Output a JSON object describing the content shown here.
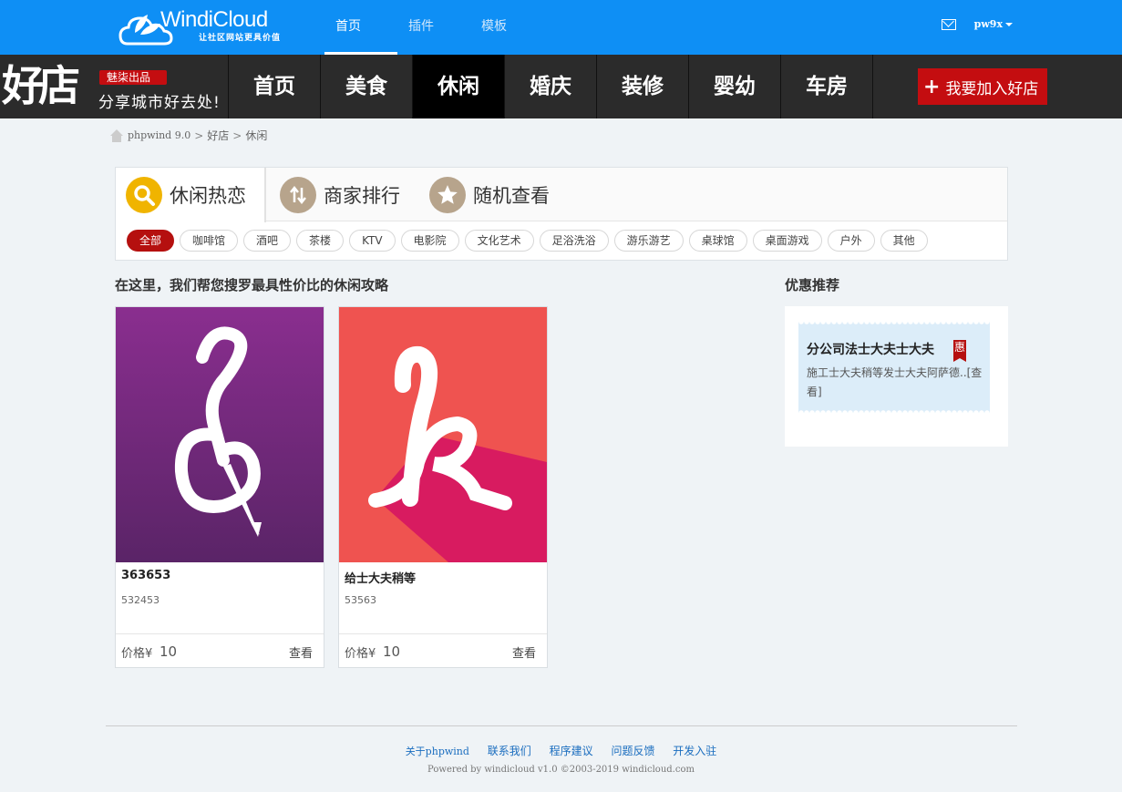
{
  "topbar": {
    "brand": "WindiCloud",
    "slogan": "让社区网站更具价值",
    "nav": [
      "首页",
      "插件",
      "模板"
    ],
    "active_nav": "首页",
    "user": "pw9x"
  },
  "shop": {
    "logo_text": "好店",
    "badge": "魅柒出品",
    "tagline": "分享城市好去处!",
    "categories": [
      "首页",
      "美食",
      "休闲",
      "婚庆",
      "装修",
      "婴幼",
      "车房"
    ],
    "active_category": "休闲",
    "join_label": "我要加入好店"
  },
  "breadcrumb": [
    "phpwind 9.0",
    "好店",
    "休闲"
  ],
  "tabs": [
    {
      "label": "休闲热恋",
      "icon": "search-icon",
      "color": "#f0b400"
    },
    {
      "label": "商家排行",
      "icon": "sort-arrows-icon",
      "color": "#b7a48c"
    },
    {
      "label": "随机查看",
      "icon": "star-icon",
      "color": "#b7a48c"
    }
  ],
  "filters": [
    "全部",
    "咖啡馆",
    "酒吧",
    "茶楼",
    "KTV",
    "电影院",
    "文化艺术",
    "足浴洗浴",
    "游乐游艺",
    "桌球馆",
    "桌面游戏",
    "户外",
    "其他"
  ],
  "main": {
    "heading": "在这里，我们帮您搜罗最具性价比的休闲攻略",
    "cards": [
      {
        "name": "363653",
        "desc": "532453",
        "price_label": "价格¥",
        "price": "10",
        "view": "查看",
        "image_color": "#7a2b8a"
      },
      {
        "name": "给士大夫稍等",
        "desc": "53563",
        "price_label": "价格¥",
        "price": "10",
        "view": "查看",
        "image_color": "#ef5350"
      }
    ]
  },
  "sidebar": {
    "title": "优惠推荐",
    "coupon": {
      "title": "分公司法士大夫士大夫",
      "badge": "惠",
      "desc": "施工士大夫稍等发士大夫阿萨德..[查看]"
    }
  },
  "footer": {
    "links": [
      "关于phpwind",
      "联系我们",
      "程序建议",
      "问题反馈",
      "开发入驻"
    ],
    "copyright": "Powered by windicloud v1.0 ©2003-2019 windicloud.com"
  }
}
